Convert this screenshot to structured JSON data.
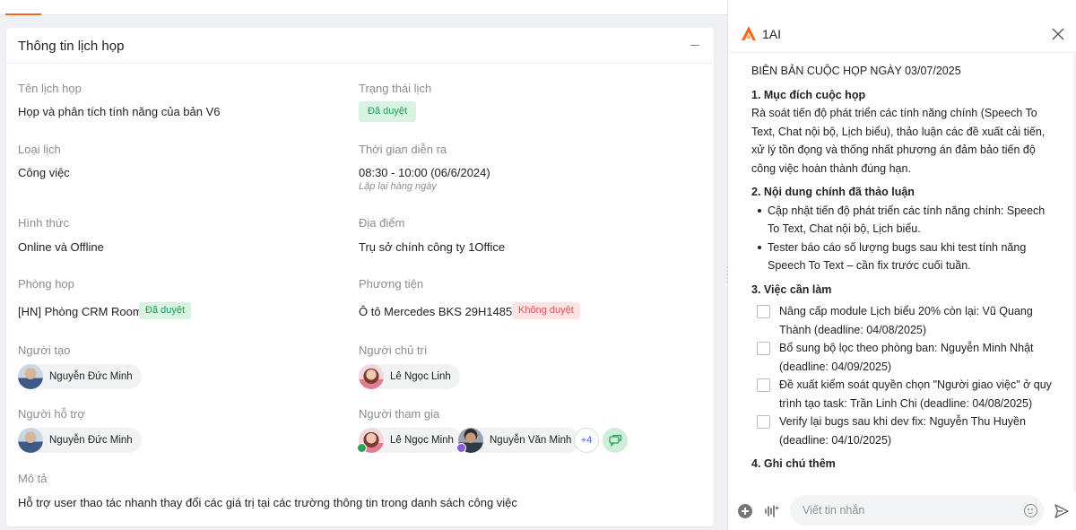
{
  "card": {
    "title": "Thông tin lịch họp"
  },
  "fields": {
    "ten_lich_hop": {
      "label": "Tên lịch họp",
      "value": "Họp và phân tích tính năng của bản V6"
    },
    "trang_thai_lich": {
      "label": "Trạng thái lịch",
      "badge": "Đã duyệt"
    },
    "loai_lich": {
      "label": "Loại lịch",
      "value": "Công việc"
    },
    "thoi_gian": {
      "label": "Thời gian diễn ra",
      "value": "08:30 - 10:00 (06/6/2024)",
      "sub": "Lặp lại hàng ngày"
    },
    "hinh_thuc": {
      "label": "Hình thức",
      "value": "Online và Offline"
    },
    "dia_diem": {
      "label": "Địa điểm",
      "value": "Trụ sở chính công ty 1Office"
    },
    "phong_hop": {
      "label": "Phòng họp",
      "value": "[HN] Phòng CRM Room",
      "badge": "Đã duyệt"
    },
    "phuong_tien": {
      "label": "Phương tiện",
      "value": "Ô tô Mercedes BKS 29H14858",
      "badge": "Không duyệt"
    },
    "nguoi_tao": {
      "label": "Người tạo",
      "person": "Nguyễn Đức Minh"
    },
    "nguoi_chu_tri": {
      "label": "Người chủ trì",
      "person": "Lê Ngọc Linh"
    },
    "nguoi_ho_tro": {
      "label": "Người hỗ trợ",
      "person": "Nguyễn Đức Minh"
    },
    "nguoi_tham_gia": {
      "label": "Người tham gia",
      "people": [
        "Lê Ngọc Minh",
        "Nguyễn Văn Minh"
      ],
      "more": "+4"
    },
    "mo_ta": {
      "label": "Mô tả",
      "value": "Hỗ trợ user thao tác nhanh thay đổi các giá trị tại các trường thông tin trong danh sách công việc"
    }
  },
  "colors": {
    "accent": "#f26b21",
    "approved_bg": "#d9f3e3",
    "approved_text": "#1e9b55",
    "rejected_bg": "#fde3e3",
    "rejected_text": "#e0504a",
    "more_text": "#3a6cd8"
  },
  "panel": {
    "title": "1AI",
    "icons": [
      "1ai-logo-icon",
      "close-icon",
      "plus-icon",
      "voice-icon",
      "emoji-icon",
      "send-icon"
    ],
    "doc_title": "BIÊN BẢN CUỘC HỌP NGÀY 03/07/2025",
    "s1_title": "1. Mục đích cuộc họp",
    "s1_text": "Rà soát tiến độ phát triển các tính năng chính (Speech To Text, Chat nội bộ, Lịch biểu), thảo luận các đề xuất cải tiến, xử lý tồn đọng và thống nhất phương án đảm bảo tiến độ công việc hoàn thành đúng hạn.",
    "s2_title": "2. Nội dung chính đã thảo luận",
    "s2_items": [
      "Cập nhật tiến độ phát triển các tính năng chính: Speech To Text, Chat nội bộ, Lịch biểu.",
      "Tester báo cáo số lượng bugs sau khi test tính năng Speech To Text – cần fix trước cuối tuần."
    ],
    "s3_title": "3. Việc cần làm",
    "s3_todos": [
      "Nâng cấp module Lịch biểu 20% còn lại: Vũ Quang Thành (deadline: 04/08/2025)",
      "Bổ sung bộ lọc theo phòng ban: Nguyễn Minh Nhật (deadline: 04/09/2025)",
      "Đề xuất kiểm soát quyền chọn \"Người giao việc\" ở quy trình tạo task: Trần Linh Chi (deadline: 04/08/2025)",
      "Verify lại bugs sau khi dev fix: Nguyễn Thu Huyền (deadline: 04/10/2025)"
    ],
    "s4_title": "4. Ghi chú thêm",
    "input_placeholder": "Viết tin nhắn"
  }
}
